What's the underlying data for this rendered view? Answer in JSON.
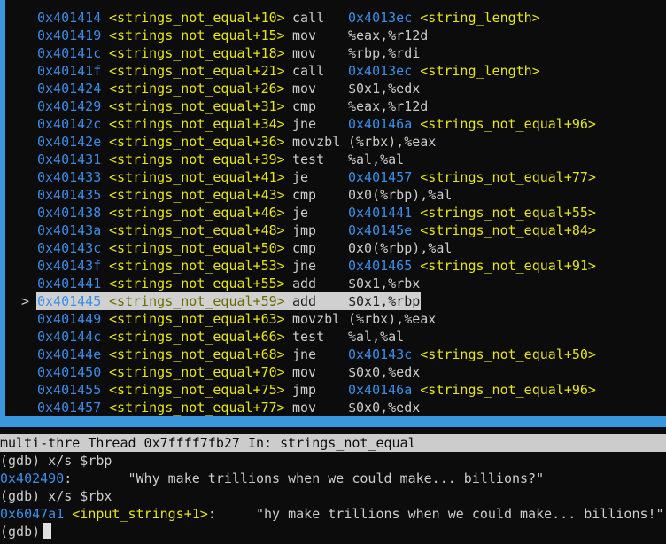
{
  "asm": {
    "lines": [
      {
        "marker": "",
        "addr": "0x401414",
        "sym": "<strings_not_equal+10>",
        "mnem": "call",
        "ops_plain": "",
        "target_addr": "0x4013ec",
        "target_sym": "<string_length>"
      },
      {
        "marker": "",
        "addr": "0x401419",
        "sym": "<strings_not_equal+15>",
        "mnem": "mov",
        "ops_plain": "%eax,%r12d",
        "target_addr": "",
        "target_sym": ""
      },
      {
        "marker": "",
        "addr": "0x40141c",
        "sym": "<strings_not_equal+18>",
        "mnem": "mov",
        "ops_plain": "%rbp,%rdi",
        "target_addr": "",
        "target_sym": ""
      },
      {
        "marker": "",
        "addr": "0x40141f",
        "sym": "<strings_not_equal+21>",
        "mnem": "call",
        "ops_plain": "",
        "target_addr": "0x4013ec",
        "target_sym": "<string_length>"
      },
      {
        "marker": "",
        "addr": "0x401424",
        "sym": "<strings_not_equal+26>",
        "mnem": "mov",
        "ops_plain": "$0x1,%edx",
        "target_addr": "",
        "target_sym": ""
      },
      {
        "marker": "",
        "addr": "0x401429",
        "sym": "<strings_not_equal+31>",
        "mnem": "cmp",
        "ops_plain": "%eax,%r12d",
        "target_addr": "",
        "target_sym": ""
      },
      {
        "marker": "",
        "addr": "0x40142c",
        "sym": "<strings_not_equal+34>",
        "mnem": "jne",
        "ops_plain": "",
        "target_addr": "0x40146a",
        "target_sym": "<strings_not_equal+96>"
      },
      {
        "marker": "",
        "addr": "0x40142e",
        "sym": "<strings_not_equal+36>",
        "mnem": "movzbl",
        "ops_plain": "(%rbx),%eax",
        "target_addr": "",
        "target_sym": ""
      },
      {
        "marker": "",
        "addr": "0x401431",
        "sym": "<strings_not_equal+39>",
        "mnem": "test",
        "ops_plain": "%al,%al",
        "target_addr": "",
        "target_sym": ""
      },
      {
        "marker": "",
        "addr": "0x401433",
        "sym": "<strings_not_equal+41>",
        "mnem": "je",
        "ops_plain": "",
        "target_addr": "0x401457",
        "target_sym": "<strings_not_equal+77>"
      },
      {
        "marker": "",
        "addr": "0x401435",
        "sym": "<strings_not_equal+43>",
        "mnem": "cmp",
        "ops_plain": "0x0(%rbp),%al",
        "target_addr": "",
        "target_sym": ""
      },
      {
        "marker": "",
        "addr": "0x401438",
        "sym": "<strings_not_equal+46>",
        "mnem": "je",
        "ops_plain": "",
        "target_addr": "0x401441",
        "target_sym": "<strings_not_equal+55>"
      },
      {
        "marker": "",
        "addr": "0x40143a",
        "sym": "<strings_not_equal+48>",
        "mnem": "jmp",
        "ops_plain": "",
        "target_addr": "0x40145e",
        "target_sym": "<strings_not_equal+84>"
      },
      {
        "marker": "",
        "addr": "0x40143c",
        "sym": "<strings_not_equal+50>",
        "mnem": "cmp",
        "ops_plain": "0x0(%rbp),%al",
        "target_addr": "",
        "target_sym": ""
      },
      {
        "marker": "",
        "addr": "0x40143f",
        "sym": "<strings_not_equal+53>",
        "mnem": "jne",
        "ops_plain": "",
        "target_addr": "0x401465",
        "target_sym": "<strings_not_equal+91>"
      },
      {
        "marker": "",
        "addr": "0x401441",
        "sym": "<strings_not_equal+55>",
        "mnem": "add",
        "ops_plain": "$0x1,%rbx",
        "target_addr": "",
        "target_sym": ""
      },
      {
        "marker": ">",
        "addr": "0x401445",
        "sym": "<strings_not_equal+59>",
        "mnem": "add",
        "ops_plain": "$0x1,%rbp",
        "target_addr": "",
        "target_sym": "",
        "current": true
      },
      {
        "marker": "",
        "addr": "0x401449",
        "sym": "<strings_not_equal+63>",
        "mnem": "movzbl",
        "ops_plain": "(%rbx),%eax",
        "target_addr": "",
        "target_sym": ""
      },
      {
        "marker": "",
        "addr": "0x40144c",
        "sym": "<strings_not_equal+66>",
        "mnem": "test",
        "ops_plain": "%al,%al",
        "target_addr": "",
        "target_sym": ""
      },
      {
        "marker": "",
        "addr": "0x40144e",
        "sym": "<strings_not_equal+68>",
        "mnem": "jne",
        "ops_plain": "",
        "target_addr": "0x40143c",
        "target_sym": "<strings_not_equal+50>"
      },
      {
        "marker": "",
        "addr": "0x401450",
        "sym": "<strings_not_equal+70>",
        "mnem": "mov",
        "ops_plain": "$0x0,%edx",
        "target_addr": "",
        "target_sym": ""
      },
      {
        "marker": "",
        "addr": "0x401455",
        "sym": "<strings_not_equal+75>",
        "mnem": "jmp",
        "ops_plain": "",
        "target_addr": "0x40146a",
        "target_sym": "<strings_not_equal+96>"
      },
      {
        "marker": "",
        "addr": "0x401457",
        "sym": "<strings_not_equal+77>",
        "mnem": "mov",
        "ops_plain": "$0x0,%edx",
        "target_addr": "",
        "target_sym": ""
      }
    ]
  },
  "status": {
    "text": "multi-thre Thread 0x7ffff7fb27 In: strings_not_equal"
  },
  "console": {
    "lines": [
      {
        "prefix": "(gdb) x/s $rbp",
        "addr": "",
        "sym": "",
        "rest": ""
      },
      {
        "prefix": "",
        "addr": "0x402490",
        "sym": "",
        "rest": ":       \"Why make trillions when we could make... billions?\""
      },
      {
        "prefix": "(gdb) x/s $rbx",
        "addr": "",
        "sym": "",
        "rest": ""
      },
      {
        "prefix": "",
        "addr": "0x6047a1",
        "sym": "<input_strings+1>",
        "rest": ":     \"hy make trillions when we could make... billions!\""
      },
      {
        "prefix": "(gdb)",
        "addr": "",
        "sym": "",
        "rest": "",
        "cursor": true
      }
    ]
  },
  "colors": {
    "background": "#0c0c0c",
    "border": "#3a96dd",
    "address": "#3b8eea",
    "symbol": "#e5e510",
    "text": "#cccccc",
    "highlight": "#d0d0d0"
  }
}
